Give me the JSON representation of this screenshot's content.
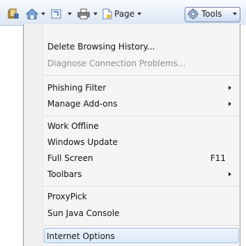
{
  "toolbar": {
    "page_label": "Page",
    "tools_label": "Tools"
  },
  "menu": {
    "delete_history": "Delete Browsing History...",
    "diagnose": "Diagnose Connection Problems...",
    "phishing": "Phishing Filter",
    "addons": "Manage Add-ons",
    "work_offline": "Work Offline",
    "windows_update": "Windows Update",
    "full_screen": "Full Screen",
    "full_screen_shortcut": "F11",
    "toolbars": "Toolbars",
    "proxypick": "ProxyPick",
    "java_console": "Sun Java Console",
    "internet_options": "Internet Options"
  },
  "colors": {
    "toolbar_bg": "#e6eef7",
    "highlight_border": "#9fc0e6",
    "disabled_text": "#8e8e8e"
  }
}
